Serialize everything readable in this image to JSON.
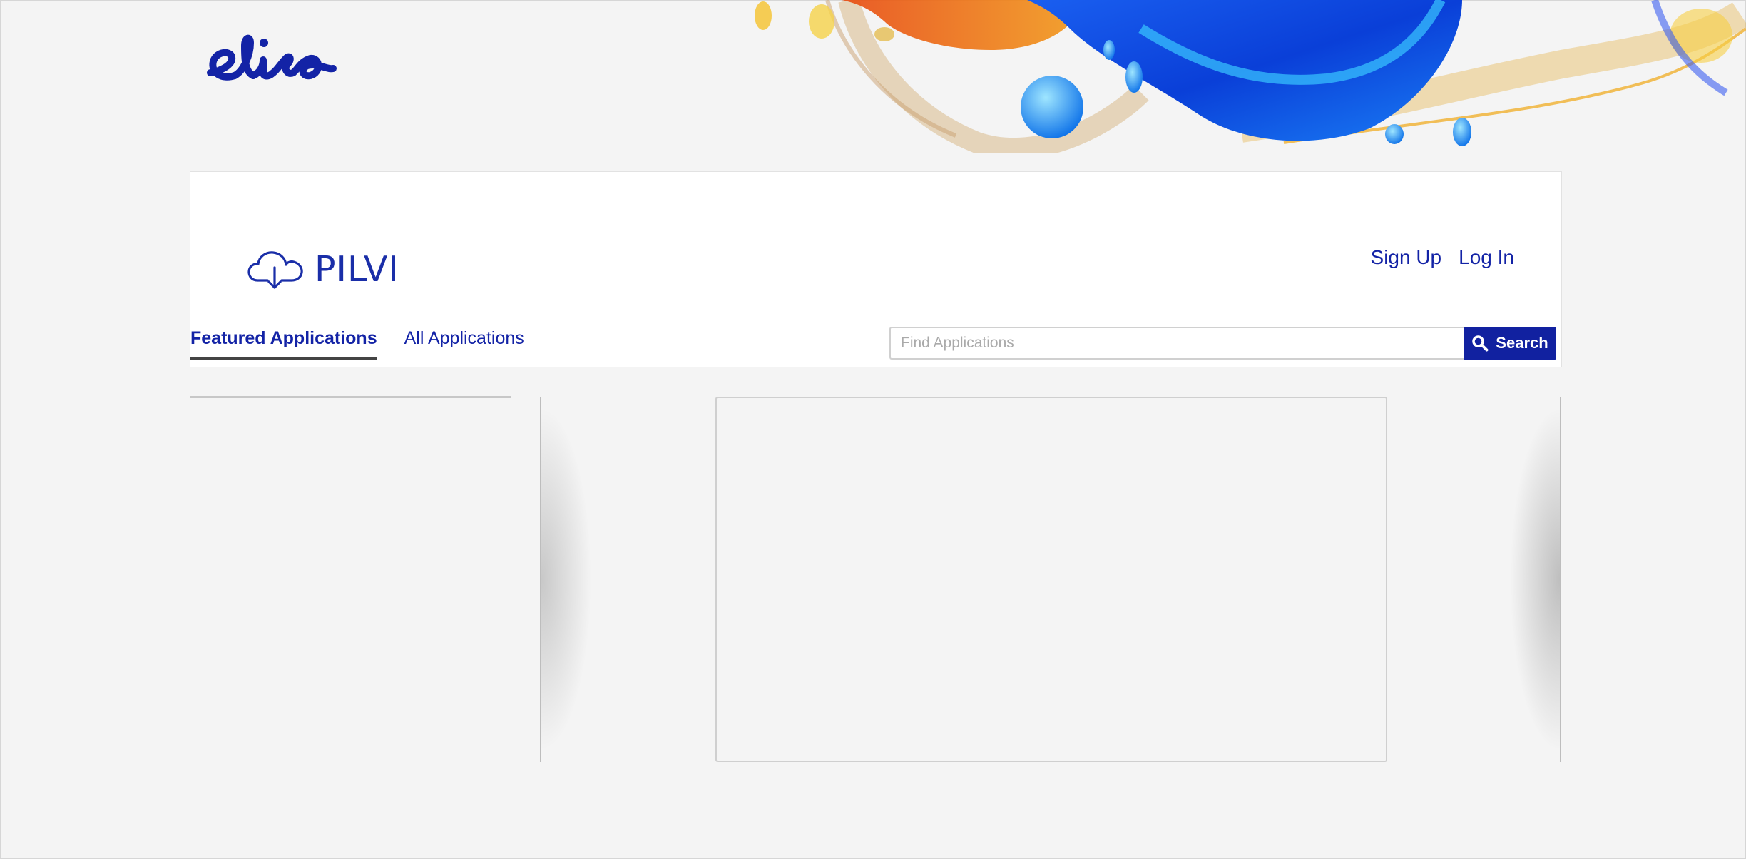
{
  "brand": {
    "logo_text": "elisa",
    "brand_color": "#1323a6"
  },
  "header": {
    "product_name": "PILVI",
    "auth": {
      "sign_up": "Sign Up",
      "log_in": "Log In"
    }
  },
  "tabs": [
    {
      "label": "Featured Applications",
      "active": true
    },
    {
      "label": "All Applications",
      "active": false
    }
  ],
  "search": {
    "placeholder": "Find Applications",
    "value": "",
    "button_label": "Search",
    "button_color": "#1121a0"
  },
  "icons": {
    "cloud": "cloud-download-icon",
    "search": "magnifier-icon"
  }
}
